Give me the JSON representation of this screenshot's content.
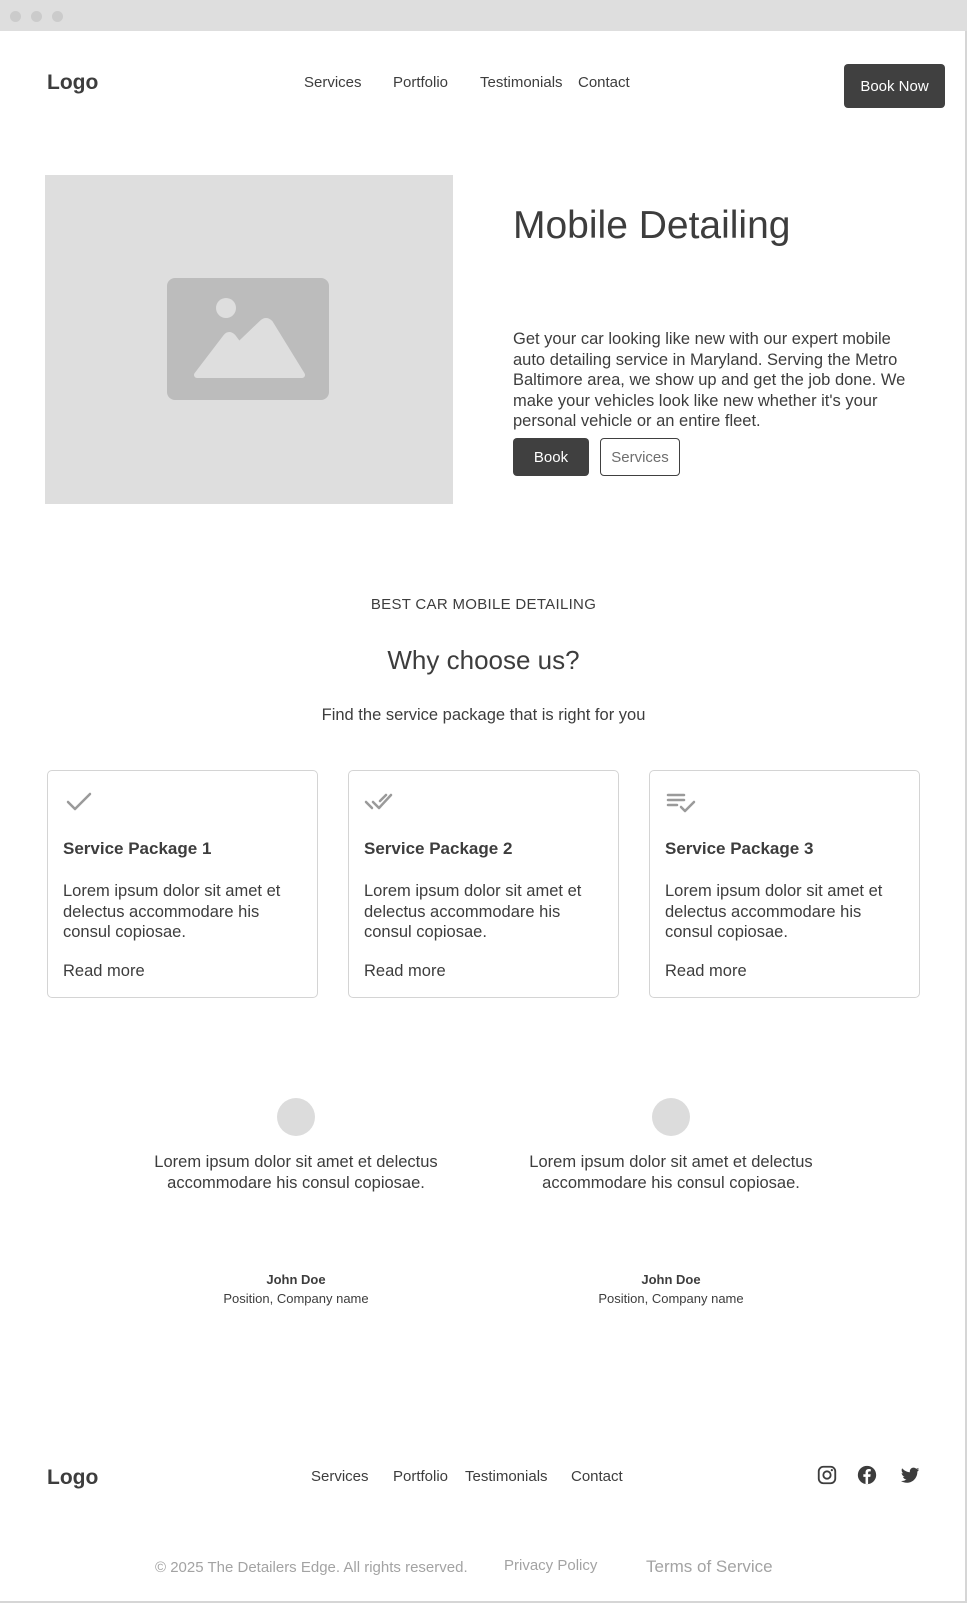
{
  "header": {
    "logo": "Logo",
    "nav": [
      "Services",
      "Portfolio",
      "Testimonials",
      "Contact"
    ],
    "cta": "Book Now"
  },
  "hero": {
    "title": "Mobile Detailing",
    "text": "Get your car looking like new with our expert mobile auto detailing service in Maryland. Serving the Metro Baltimore area, we show up and get the job done. We make your vehicles look like new whether it's your personal vehicle or an entire fleet.",
    "primary_button": "Book",
    "secondary_button": "Services",
    "image_icon": "image-placeholder-icon"
  },
  "why": {
    "eyebrow": "BEST CAR MOBILE DETAILING",
    "title": "Why choose us?",
    "subtitle": "Find the service package that is right for you"
  },
  "packages": [
    {
      "icon": "check-icon",
      "title": "Service Package 1",
      "text": "Lorem ipsum dolor sit amet et delectus accommodare his consul copiosae.",
      "link": "Read more"
    },
    {
      "icon": "double-check-icon",
      "title": "Service Package 2",
      "text": "Lorem ipsum dolor sit amet et delectus accommodare his consul copiosae.",
      "link": "Read more"
    },
    {
      "icon": "checklist-icon",
      "title": "Service Package 3",
      "text": "Lorem ipsum dolor sit amet et delectus accommodare his consul copiosae.",
      "link": "Read more"
    }
  ],
  "testimonials": [
    {
      "quote": "Lorem ipsum dolor sit amet et delectus accommodare his consul copiosae.",
      "name": "John Doe",
      "position": "Position, Company name"
    },
    {
      "quote": "Lorem ipsum dolor sit amet et delectus accommodare his consul copiosae.",
      "name": "John Doe",
      "position": "Position, Company name"
    }
  ],
  "footer": {
    "logo": "Logo",
    "nav": [
      "Services",
      "Portfolio",
      "Testimonials",
      "Contact"
    ],
    "social_icons": [
      "instagram-icon",
      "facebook-icon",
      "twitter-icon"
    ],
    "copyright": "© 2025 The Detailers Edge. All rights reserved.",
    "privacy": "Privacy Policy",
    "terms": "Terms of Service"
  },
  "colors": {
    "text": "#3d3d3d",
    "button_dark": "#404040",
    "placeholder": "#dedede",
    "muted": "#a3a3a3"
  }
}
